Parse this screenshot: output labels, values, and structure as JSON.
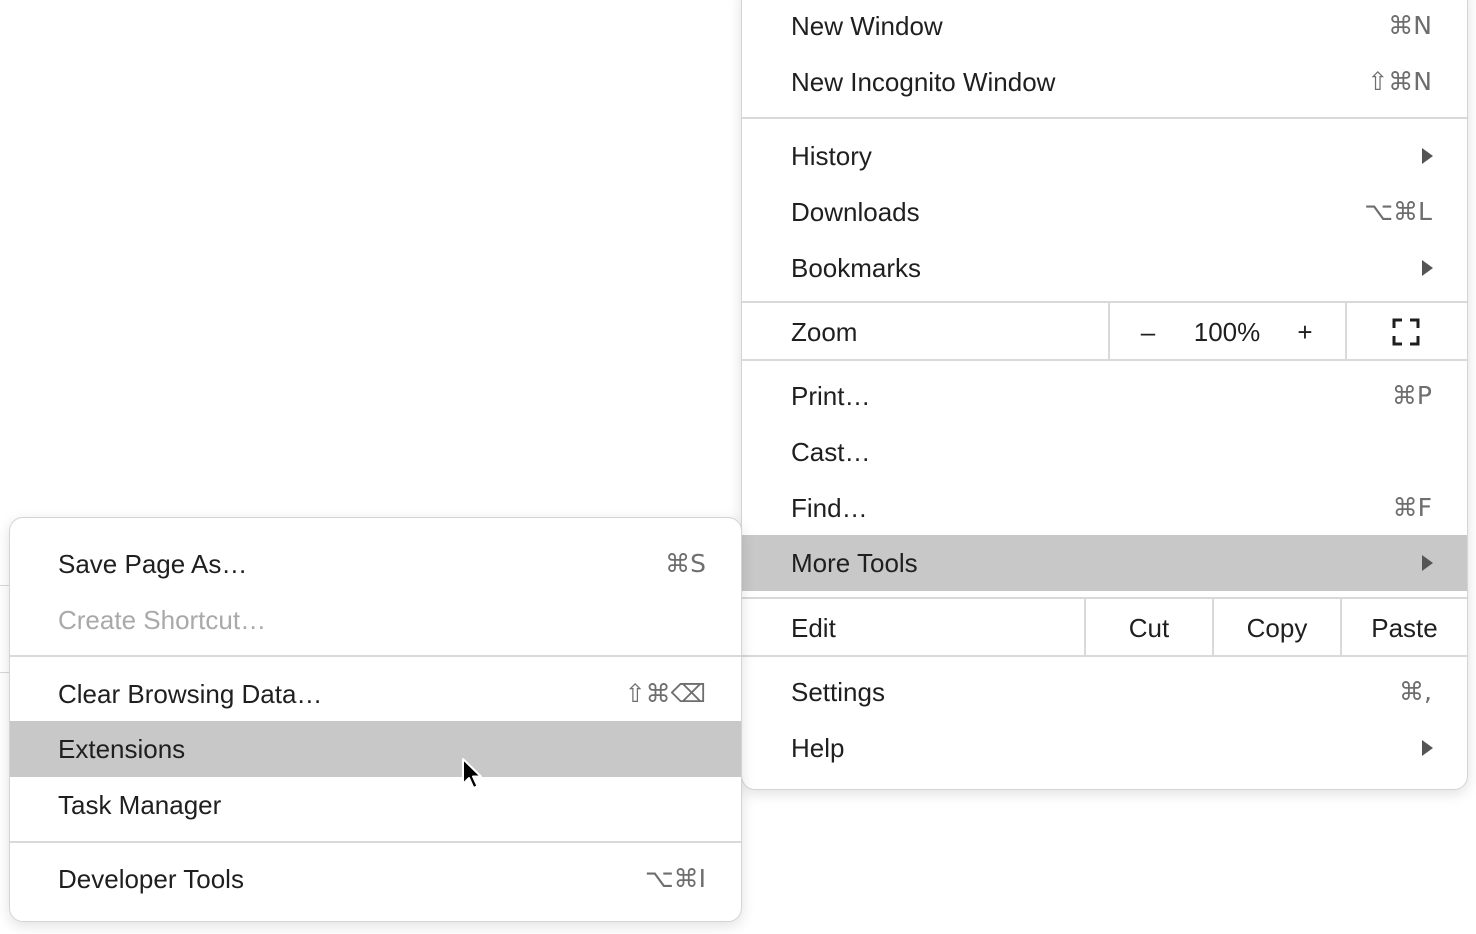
{
  "main_menu": {
    "new_window": {
      "label": "New Window",
      "shortcut": "⌘N"
    },
    "new_incognito": {
      "label": "New Incognito Window",
      "shortcut": "⇧⌘N"
    },
    "history": {
      "label": "History"
    },
    "downloads": {
      "label": "Downloads",
      "shortcut": "⌥⌘L"
    },
    "bookmarks": {
      "label": "Bookmarks"
    },
    "zoom": {
      "label": "Zoom",
      "minus": "–",
      "level": "100%",
      "plus": "+"
    },
    "print": {
      "label": "Print…",
      "shortcut": "⌘P"
    },
    "cast": {
      "label": "Cast…"
    },
    "find": {
      "label": "Find…",
      "shortcut": "⌘F"
    },
    "more_tools": {
      "label": "More Tools"
    },
    "edit": {
      "label": "Edit",
      "cut": "Cut",
      "copy": "Copy",
      "paste": "Paste"
    },
    "settings": {
      "label": "Settings",
      "shortcut": "⌘,"
    },
    "help": {
      "label": "Help"
    }
  },
  "sub_menu": {
    "save_page": {
      "label": "Save Page As…",
      "shortcut": "⌘S"
    },
    "create_shortcut": {
      "label": "Create Shortcut…"
    },
    "clear_browsing": {
      "label": "Clear Browsing Data…",
      "shortcut": "⇧⌘⌫"
    },
    "extensions": {
      "label": "Extensions"
    },
    "task_manager": {
      "label": "Task Manager"
    },
    "developer_tools": {
      "label": "Developer Tools",
      "shortcut": "⌥⌘I"
    }
  },
  "colors": {
    "highlight": "#c8c8c8",
    "separator": "#d9d9d9",
    "disabled_text": "#a9a9a9",
    "shortcut_text": "#6e6e6e"
  },
  "icons": {
    "submenu_arrow": "chevron-right-icon",
    "fullscreen": "fullscreen-icon",
    "cursor": "mouse-pointer-icon"
  }
}
